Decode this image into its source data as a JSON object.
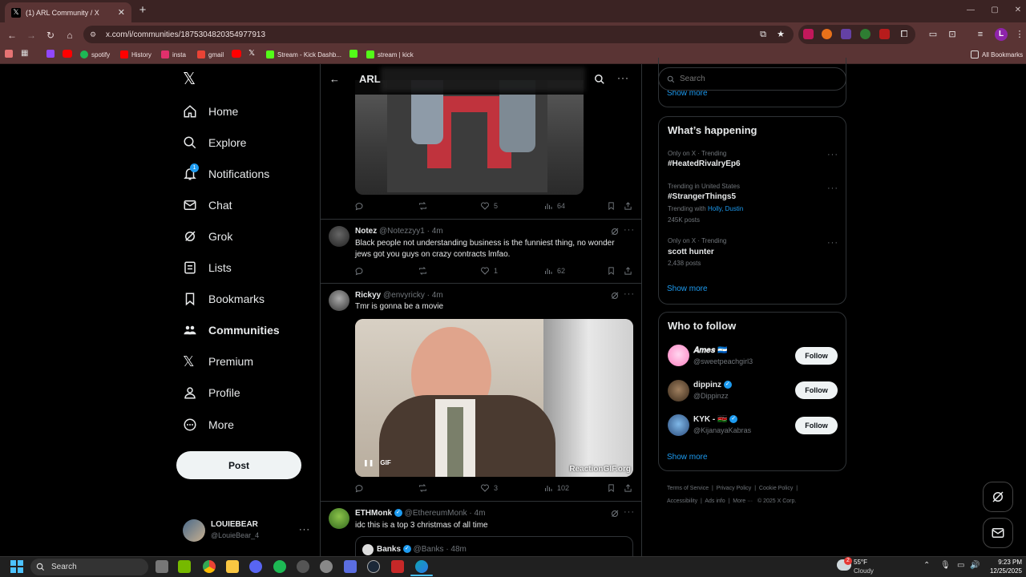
{
  "browser": {
    "tab_title": "(1) ARL Community / X",
    "url": "x.com/i/communities/1875304820354977913",
    "bookmarks": [
      "spotify",
      "History",
      "insta",
      "gmail",
      "Stream - Kick Dashb...",
      "stream | kick"
    ],
    "all_bookmarks": "All Bookmarks"
  },
  "nav": {
    "items": [
      "Home",
      "Explore",
      "Notifications",
      "Chat",
      "Grok",
      "Lists",
      "Bookmarks",
      "Communities",
      "Premium",
      "Profile",
      "More"
    ],
    "notif_badge": "1",
    "post_label": "Post",
    "user_name": "LOUIEBEAR",
    "user_handle": "@LouieBear_4"
  },
  "header": {
    "title": "ARL"
  },
  "tweets": [
    {
      "actions": {
        "reply": "",
        "retweet": "",
        "like": "5",
        "views": "64"
      }
    },
    {
      "name": "Notez",
      "handle": "@Notezzyy1",
      "time": "· 4m",
      "text": "Black people not understanding business is the funniest thing, no wonder jews got you guys on crazy contracts lmfao.",
      "actions": {
        "reply": "",
        "retweet": "",
        "like": "1",
        "views": "62"
      }
    },
    {
      "name": "Rickyy",
      "handle": "@envyricky",
      "time": "· 4m",
      "text": "Tmr is gonna be a movie",
      "gif_badge": "GIF",
      "watermark": "ReactionGIF.org",
      "actions": {
        "reply": "",
        "retweet": "",
        "like": "3",
        "views": "102"
      }
    },
    {
      "name": "ETHMonk",
      "handle": "@EthereumMonk",
      "time": "· 4m",
      "text": "idc this is a top 3 christmas of all time",
      "quote": {
        "name": "Banks",
        "handle": "@Banks",
        "time": "· 48m"
      }
    }
  ],
  "search": {
    "placeholder": "Search"
  },
  "show_more_top": "Show more",
  "whats_happening": {
    "title": "What’s happening",
    "trends": [
      {
        "meta": "Only on X · Trending",
        "name": "#HeatedRivalryEp6",
        "posts": ""
      },
      {
        "meta": "Trending in United States",
        "name": "#StrangerThings5",
        "trending_with_label": "Trending with",
        "trending_with": "Holly, Dustin",
        "posts": "245K posts"
      },
      {
        "meta": "Only on X · Trending",
        "name": "scott hunter",
        "posts": "2,438 posts"
      }
    ],
    "show_more": "Show more"
  },
  "who_to_follow": {
    "title": "Who to follow",
    "users": [
      {
        "name": "𝑨𝒎𝒆𝒔 🇳🇮",
        "handle": "@sweetpeachgirl3",
        "button": "Follow"
      },
      {
        "name": "dippinz",
        "handle": "@Dippinzz",
        "button": "Follow"
      },
      {
        "name": "KYK - 🇰🇪",
        "handle": "@KijanayaKabras",
        "button": "Follow"
      }
    ],
    "show_more": "Show more"
  },
  "footer": {
    "links": [
      "Terms of Service",
      "Privacy Policy",
      "Cookie Policy",
      "Accessibility",
      "Ads info",
      "More ···",
      "© 2025 X Corp."
    ]
  },
  "taskbar": {
    "search": "Search",
    "weather_temp": "55°F",
    "weather_desc": "Cloudy",
    "weather_badge": "2",
    "time": "9:23 PM",
    "date": "12/25/2025"
  },
  "colors": {
    "accent": "#1d9bf0",
    "browser_frame": "#5a3434",
    "background": "#000000",
    "border": "#2f3336"
  }
}
